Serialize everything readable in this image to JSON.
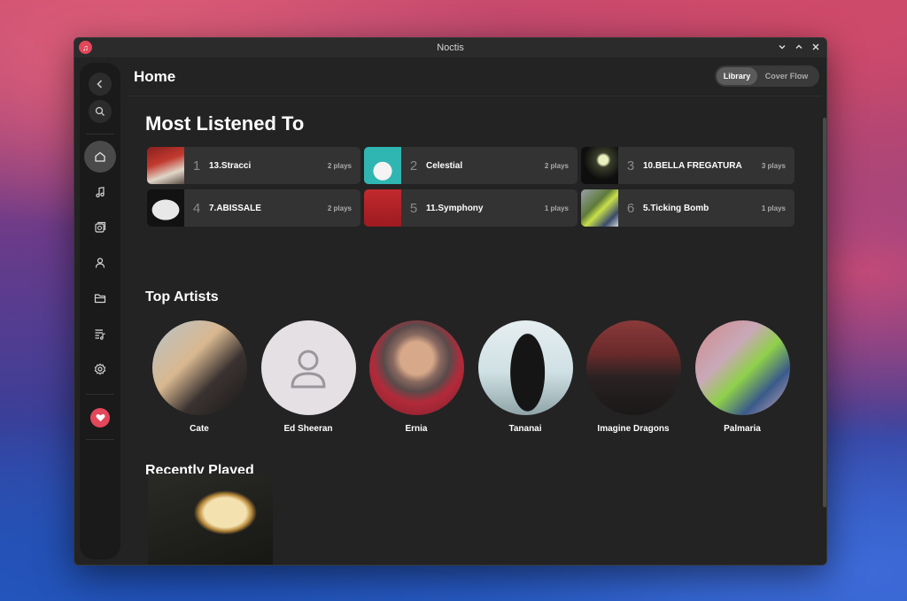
{
  "window": {
    "title": "Noctis",
    "controls": [
      "minimize",
      "maximize",
      "close"
    ]
  },
  "sidebar": {
    "items": [
      {
        "icon": "back-icon"
      },
      {
        "icon": "search-icon"
      },
      {
        "icon": "home-icon",
        "active": true
      },
      {
        "icon": "music-note-icon"
      },
      {
        "icon": "albums-icon"
      },
      {
        "icon": "artist-icon"
      },
      {
        "icon": "folder-icon"
      },
      {
        "icon": "playlist-icon"
      },
      {
        "icon": "settings-icon"
      },
      {
        "icon": "heart-icon"
      }
    ]
  },
  "header": {
    "title": "Home",
    "view_toggle": {
      "library": "Library",
      "cover_flow": "Cover Flow",
      "selected": "Library"
    }
  },
  "most_listened": {
    "heading": "Most Listened To",
    "tracks": [
      {
        "rank": "1",
        "name": "13.Stracci",
        "plays": "2 plays",
        "thumb_color": "#7a2a2a"
      },
      {
        "rank": "2",
        "name": "Celestial",
        "plays": "2 plays",
        "thumb_color": "#2fb6b3"
      },
      {
        "rank": "3",
        "name": "10.BELLA FREGATURA",
        "plays": "3 plays",
        "thumb_color": "#111111"
      },
      {
        "rank": "4",
        "name": "7.ABISSALE",
        "plays": "2 plays",
        "thumb_color": "#1b1b1b"
      },
      {
        "rank": "5",
        "name": "11.Symphony",
        "plays": "1 plays",
        "thumb_color": "#b8262a"
      },
      {
        "rank": "6",
        "name": "5.Ticking Bomb",
        "plays": "1 plays",
        "thumb_color": "#6a6f5a"
      }
    ]
  },
  "top_artists": {
    "heading": "Top Artists",
    "artists": [
      {
        "name": "Cate"
      },
      {
        "name": "Ed Sheeran"
      },
      {
        "name": "Ernia"
      },
      {
        "name": "Tananai"
      },
      {
        "name": "Imagine Dragons"
      },
      {
        "name": "Palmaria"
      }
    ]
  },
  "recently_played": {
    "heading": "Recently Played"
  },
  "colors": {
    "accent": "#e2475a",
    "window_bg": "#232323",
    "card_bg": "#333333",
    "sidebar_bg": "#1a1a1a"
  }
}
